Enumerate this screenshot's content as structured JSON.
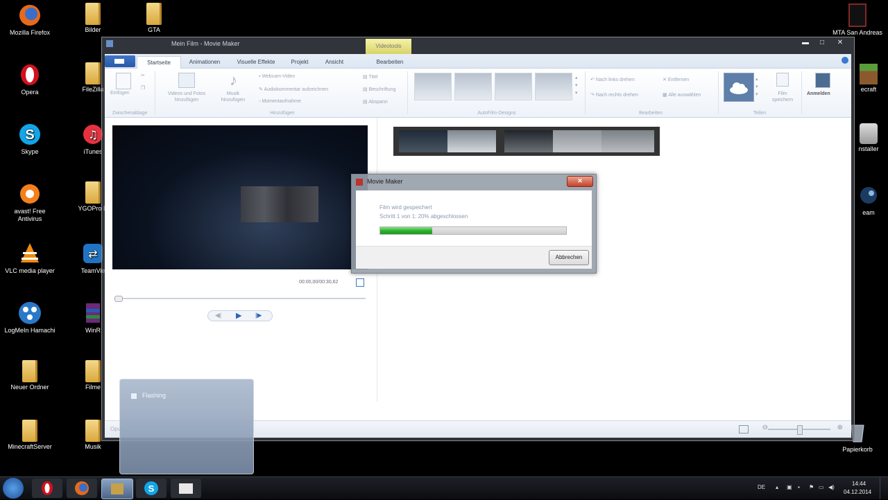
{
  "desktop": {
    "icons_left": [
      {
        "label": "Mozilla Firefox",
        "icon": "firefox-icon"
      },
      {
        "label": "Opera",
        "icon": "opera-icon"
      },
      {
        "label": "Skype",
        "icon": "skype-icon"
      },
      {
        "label": "avast! Free Antivirus",
        "icon": "avast-icon"
      },
      {
        "label": "VLC media player",
        "icon": "vlc-icon"
      },
      {
        "label": "LogMeIn Hamachi",
        "icon": "hamachi-icon"
      },
      {
        "label": "Neuer Ordner",
        "icon": "folder-icon"
      },
      {
        "label": "MinecraftServer",
        "icon": "folder-icon"
      }
    ],
    "icons_col2": [
      {
        "label": "Bilder",
        "icon": "folder-icon"
      },
      {
        "label": "FileZilla",
        "icon": "filezilla-icon"
      },
      {
        "label": "iTunes",
        "icon": "itunes-icon"
      },
      {
        "label": "YGOPro D",
        "icon": "folder-icon"
      },
      {
        "label": "TeamVie",
        "icon": "teamviewer-icon"
      },
      {
        "label": "WinR",
        "icon": "winrar-icon"
      },
      {
        "label": "Filme",
        "icon": "folder-icon"
      },
      {
        "label": "Musik",
        "icon": "folder-icon"
      }
    ],
    "icon_top3": {
      "label": "GTA",
      "icon": "folder-icon"
    },
    "icons_right": [
      {
        "label": "MTA San Andreas",
        "icon": "mta-icon"
      },
      {
        "label": "ecraft",
        "icon": "minecraft-icon"
      },
      {
        "label": "nstaller",
        "icon": "installer-icon"
      },
      {
        "label": "eam",
        "icon": "steam-icon"
      },
      {
        "label": "Papierkorb",
        "icon": "recycle-bin-icon"
      }
    ]
  },
  "window": {
    "title": "Mein Film - Movie Maker",
    "context_tab": "Videotools",
    "tabs": [
      "Startseite",
      "Animationen",
      "Visuelle Effekte",
      "Projekt",
      "Ansicht",
      "Bearbeiten"
    ],
    "ribbon": {
      "clipboard": {
        "paste": "Einfügen",
        "caption": "Zwischenablage"
      },
      "add": {
        "add_videos": "Videos und Fotos hinzufügen",
        "add_music": "Musik hinzufügen",
        "webcam": "Webcam-Video",
        "narration": "Audiokommentar aufzeichnen",
        "snapshot": "Momentaufnahme",
        "title": "Titel",
        "caption": "Beschriftung",
        "credits": "Abspann",
        "group_caption": "Hinzufügen"
      },
      "automovie": {
        "caption": "AutoFilm-Designs"
      },
      "edit": {
        "rotate_left": "Nach links drehen",
        "rotate_right": "Nach rechts drehen",
        "remove": "Entfernen",
        "select_all": "Alle auswählen",
        "caption": "Bearbeiten"
      },
      "share": {
        "save_movie": "Film speichern",
        "caption": "Teilen",
        "signin": "Anmelden"
      }
    },
    "preview": {
      "timecode": "00:00,00/00:30,62"
    },
    "status_left": "Opvr..."
  },
  "dialog": {
    "title": "Movie Maker",
    "line1": "Film wird gespeichert",
    "line2": "Schritt 1 von 1: 20% abgeschlossen",
    "progress": 0.28,
    "cancel": "Abbrechen"
  },
  "popup": {
    "label": "Flashing"
  },
  "taskbar": {
    "items": [
      "start-orb",
      "opera",
      "firefox",
      "movie-maker",
      "skype",
      "explorer"
    ],
    "lang": "DE",
    "time": "14:44",
    "date": "04.12.2014"
  }
}
